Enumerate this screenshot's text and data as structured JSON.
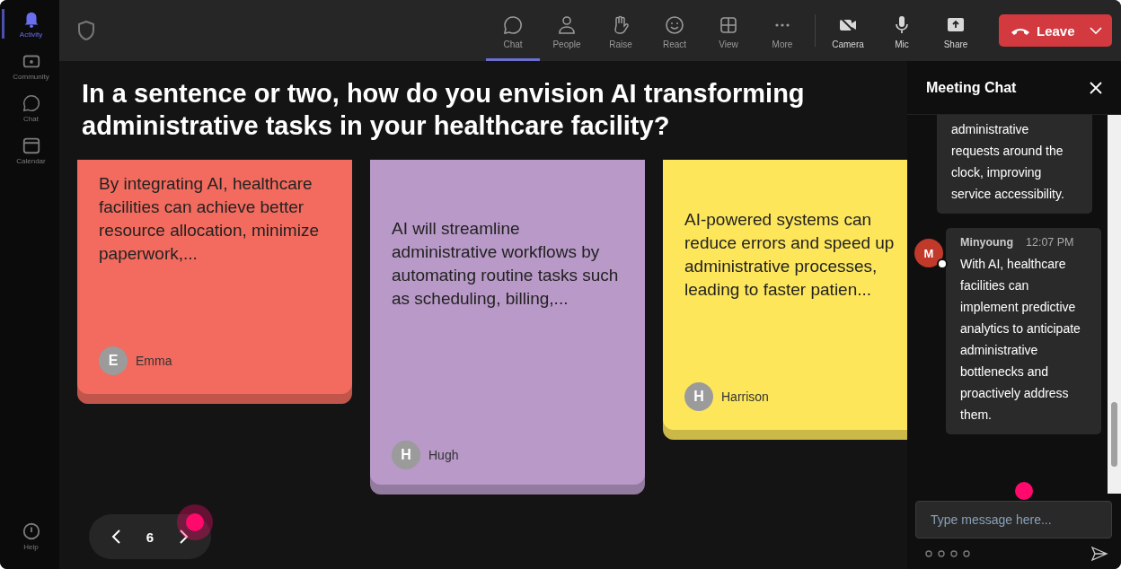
{
  "rail": {
    "items": [
      {
        "label": "Activity",
        "selected": true
      },
      {
        "label": "Community",
        "selected": false
      },
      {
        "label": "Chat",
        "selected": false
      },
      {
        "label": "Calendar",
        "selected": false
      }
    ],
    "help": {
      "label": "Help"
    }
  },
  "toolbar": {
    "items": [
      {
        "label": "Chat",
        "selected": true
      },
      {
        "label": "People",
        "selected": false
      },
      {
        "label": "Raise",
        "selected": false
      },
      {
        "label": "React",
        "selected": false
      },
      {
        "label": "View",
        "selected": false
      },
      {
        "label": "More",
        "selected": false
      },
      {
        "label": "Camera",
        "selected": false
      },
      {
        "label": "Mic",
        "selected": false
      },
      {
        "label": "Share",
        "selected": false
      }
    ],
    "leave": {
      "label": "Leave"
    }
  },
  "question": "In a sentence or two, how do you envision AI transforming administrative tasks in your healthcare facility?",
  "notes": [
    {
      "text": "By integrating AI, healthcare facilities can achieve better resource allocation, minimize paperwork,...",
      "author": "Emma",
      "initial": "E",
      "color": "#f26b5e"
    },
    {
      "text": "AI will streamline administrative workflows by automating routine tasks such as scheduling, billing,...",
      "author": "Hugh",
      "initial": "H",
      "color": "#b899c7"
    },
    {
      "text": "AI-powered systems can reduce errors and speed up administrative processes, leading to faster patien...",
      "author": "Harrison",
      "initial": "H",
      "color": "#fde65a"
    }
  ],
  "pager": {
    "page": "6"
  },
  "chat": {
    "title": "Meeting Chat",
    "messages": [
      {
        "text": "administrative requests around the clock, improving service accessibility."
      },
      {
        "sender": "Minyoung",
        "initial": "M",
        "time": "12:07 PM",
        "text": "With AI, healthcare facilities can implement predictive analytics to anticipate administrative bottlenecks and proactively address them."
      }
    ],
    "input": {
      "placeholder": "Type message here..."
    }
  }
}
